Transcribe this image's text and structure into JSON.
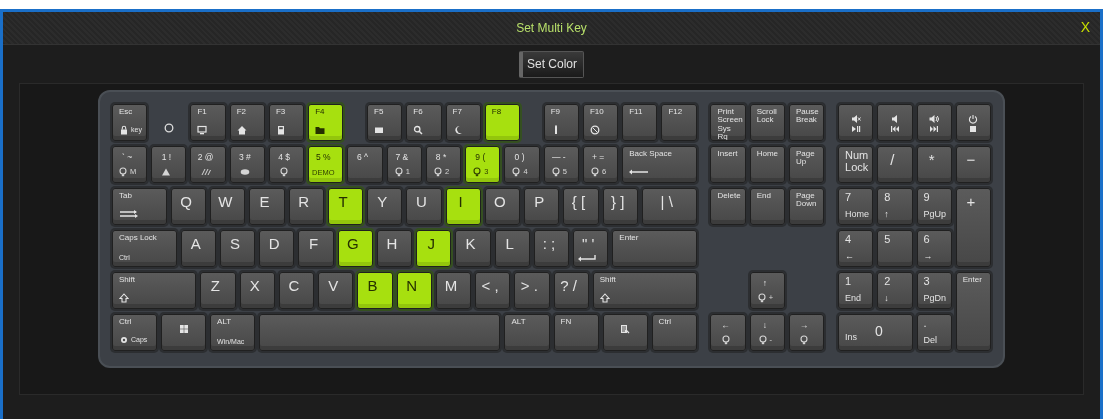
{
  "window": {
    "title": "Set Multi Key",
    "close": "X"
  },
  "toolbar": {
    "button": "Set Color"
  },
  "keyboard": {
    "rows": [
      {
        "keys": [
          {
            "kind": "fn",
            "label": "Esc",
            "sub": "key",
            "selected": false
          },
          {
            "kind": "fn",
            "label": "F1",
            "selected": false
          },
          {
            "kind": "fn",
            "label": "F2",
            "selected": false
          },
          {
            "kind": "fn",
            "label": "F3",
            "selected": false
          },
          {
            "kind": "fn",
            "label": "F4",
            "selected": true
          },
          {
            "kind": "fn",
            "label": "F5",
            "selected": false
          },
          {
            "kind": "fn",
            "label": "F6",
            "selected": false
          },
          {
            "kind": "fn",
            "label": "F7",
            "selected": false
          },
          {
            "kind": "fn",
            "label": "F8",
            "selected": true
          },
          {
            "kind": "fn",
            "label": "F9",
            "selected": false
          },
          {
            "kind": "fn",
            "label": "F10",
            "selected": false
          },
          {
            "kind": "fn",
            "label": "F11",
            "selected": false
          },
          {
            "kind": "fn",
            "label": "F12",
            "selected": false
          },
          {
            "kind": "fn",
            "label": "Print\nScreen\nSys Rq",
            "selected": false
          },
          {
            "kind": "fn",
            "label": "Scroll\nLock",
            "selected": false
          },
          {
            "kind": "fn",
            "label": "Pause\nBreak",
            "selected": false
          },
          {
            "kind": "icon",
            "selected": false
          },
          {
            "kind": "icon",
            "selected": false
          },
          {
            "kind": "icon",
            "selected": false
          },
          {
            "kind": "icon",
            "selected": false
          }
        ]
      },
      {
        "keys": [
          {
            "kind": "dual",
            "label": "` ~",
            "sub": "M",
            "selected": false
          },
          {
            "kind": "dual",
            "label": "1 !",
            "selected": false
          },
          {
            "kind": "dual",
            "label": "2 @",
            "selected": false
          },
          {
            "kind": "dual",
            "label": "3 #",
            "selected": false
          },
          {
            "kind": "dual",
            "label": "4 $",
            "selected": false
          },
          {
            "kind": "dual",
            "label": "5 %",
            "sub": "DEMO",
            "selected": true
          },
          {
            "kind": "dual",
            "label": "6 ^",
            "selected": false
          },
          {
            "kind": "dual",
            "label": "7 &",
            "sub": "1",
            "selected": false
          },
          {
            "kind": "dual",
            "label": "8 *",
            "sub": "2",
            "selected": false
          },
          {
            "kind": "dual",
            "label": "9 (",
            "sub": "3",
            "selected": true
          },
          {
            "kind": "dual",
            "label": "0 )",
            "sub": "4",
            "selected": false
          },
          {
            "kind": "dual",
            "label": "— -",
            "sub": "5",
            "selected": false
          },
          {
            "kind": "dual",
            "label": "+ =",
            "sub": "6",
            "selected": false
          },
          {
            "kind": "fn",
            "label": "Back Space",
            "selected": false
          },
          {
            "kind": "fn",
            "label": "Insert",
            "selected": false
          },
          {
            "kind": "fn",
            "label": "Home",
            "selected": false
          },
          {
            "kind": "fn",
            "label": "Page\nUp",
            "selected": false
          },
          {
            "kind": "numpad",
            "label": "Num\nLock",
            "selected": false
          },
          {
            "kind": "letter",
            "label": "/",
            "selected": false
          },
          {
            "kind": "letter",
            "label": "*",
            "selected": false
          },
          {
            "kind": "letter",
            "label": "−",
            "selected": false
          }
        ]
      },
      {
        "keys": [
          {
            "kind": "fn",
            "label": "Tab",
            "selected": false
          },
          {
            "kind": "letter",
            "label": "Q",
            "selected": false
          },
          {
            "kind": "letter",
            "label": "W",
            "selected": false
          },
          {
            "kind": "letter",
            "label": "E",
            "selected": false
          },
          {
            "kind": "letter",
            "label": "R",
            "selected": false
          },
          {
            "kind": "letter",
            "label": "T",
            "selected": true
          },
          {
            "kind": "letter",
            "label": "Y",
            "selected": false
          },
          {
            "kind": "letter",
            "label": "U",
            "selected": false
          },
          {
            "kind": "letter",
            "label": "I",
            "selected": true
          },
          {
            "kind": "letter",
            "label": "O",
            "selected": false
          },
          {
            "kind": "letter",
            "label": "P",
            "selected": false
          },
          {
            "kind": "letter",
            "label": "{ [",
            "selected": false
          },
          {
            "kind": "letter",
            "label": "} ]",
            "selected": false
          },
          {
            "kind": "letter",
            "label": "| \\",
            "selected": false
          },
          {
            "kind": "fn",
            "label": "Delete",
            "selected": false
          },
          {
            "kind": "fn",
            "label": "End",
            "selected": false
          },
          {
            "kind": "fn",
            "label": "Page\nDown",
            "selected": false
          },
          {
            "kind": "numpad",
            "label": "7",
            "sub": "Home",
            "selected": false
          },
          {
            "kind": "numpad",
            "label": "8",
            "sub": "↑",
            "selected": false
          },
          {
            "kind": "numpad",
            "label": "9",
            "sub": "PgUp",
            "selected": false
          },
          {
            "kind": "letter",
            "label": "+",
            "selected": false
          }
        ]
      },
      {
        "keys": [
          {
            "kind": "fn",
            "label": "Caps Lock",
            "sub": "Ctrl",
            "selected": false
          },
          {
            "kind": "letter",
            "label": "A",
            "selected": false
          },
          {
            "kind": "letter",
            "label": "S",
            "selected": false
          },
          {
            "kind": "letter",
            "label": "D",
            "selected": false
          },
          {
            "kind": "letter",
            "label": "F",
            "selected": false
          },
          {
            "kind": "letter",
            "label": "G",
            "selected": true
          },
          {
            "kind": "letter",
            "label": "H",
            "selected": false
          },
          {
            "kind": "letter",
            "label": "J",
            "selected": true
          },
          {
            "kind": "letter",
            "label": "K",
            "selected": false
          },
          {
            "kind": "letter",
            "label": "L",
            "selected": false
          },
          {
            "kind": "letter",
            "label": ": ;",
            "selected": false
          },
          {
            "kind": "letter",
            "label": "\" '",
            "selected": false
          },
          {
            "kind": "fn",
            "label": "Enter",
            "selected": false
          },
          {
            "kind": "numpad",
            "label": "4",
            "sub": "←",
            "selected": false
          },
          {
            "kind": "numpad",
            "label": "5",
            "selected": false
          },
          {
            "kind": "numpad",
            "label": "6",
            "sub": "→",
            "selected": false
          }
        ]
      },
      {
        "keys": [
          {
            "kind": "fn",
            "label": "Shift",
            "selected": false
          },
          {
            "kind": "letter",
            "label": "Z",
            "selected": false
          },
          {
            "kind": "letter",
            "label": "X",
            "selected": false
          },
          {
            "kind": "letter",
            "label": "C",
            "selected": false
          },
          {
            "kind": "letter",
            "label": "V",
            "selected": false
          },
          {
            "kind": "letter",
            "label": "B",
            "selected": true
          },
          {
            "kind": "letter",
            "label": "N",
            "selected": true
          },
          {
            "kind": "letter",
            "label": "M",
            "selected": false
          },
          {
            "kind": "letter",
            "label": "< ,",
            "selected": false
          },
          {
            "kind": "letter",
            "label": "> .",
            "selected": false
          },
          {
            "kind": "letter",
            "label": "? /",
            "selected": false
          },
          {
            "kind": "fn",
            "label": "Shift",
            "selected": false
          },
          {
            "kind": "dual",
            "label": "↑",
            "sub": "+",
            "selected": false
          },
          {
            "kind": "numpad",
            "label": "1",
            "sub": "End",
            "selected": false
          },
          {
            "kind": "numpad",
            "label": "2",
            "sub": "↓",
            "selected": false
          },
          {
            "kind": "numpad",
            "label": "3",
            "sub": "PgDn",
            "selected": false
          },
          {
            "kind": "mid",
            "label": "Enter",
            "selected": false
          }
        ]
      },
      {
        "keys": [
          {
            "kind": "fn",
            "label": "Ctrl",
            "sub": "Caps",
            "selected": false
          },
          {
            "kind": "icon",
            "selected": false
          },
          {
            "kind": "fn",
            "label": "ALT",
            "sub": "Win/Mac",
            "selected": false
          },
          {
            "kind": "space",
            "selected": false
          },
          {
            "kind": "fn",
            "label": "ALT",
            "selected": false
          },
          {
            "kind": "fn",
            "label": "FN",
            "selected": false
          },
          {
            "kind": "icon",
            "selected": false
          },
          {
            "kind": "fn",
            "label": "Ctrl",
            "selected": false
          },
          {
            "kind": "dual",
            "label": "←",
            "selected": false
          },
          {
            "kind": "dual",
            "label": "↓",
            "sub": "-",
            "selected": false
          },
          {
            "kind": "dual",
            "label": "→",
            "selected": false
          },
          {
            "kind": "zero",
            "label": "0",
            "sub": "Ins",
            "selected": false
          },
          {
            "kind": "numpad",
            "label": ".",
            "sub": "Del",
            "selected": false
          }
        ]
      }
    ]
  }
}
